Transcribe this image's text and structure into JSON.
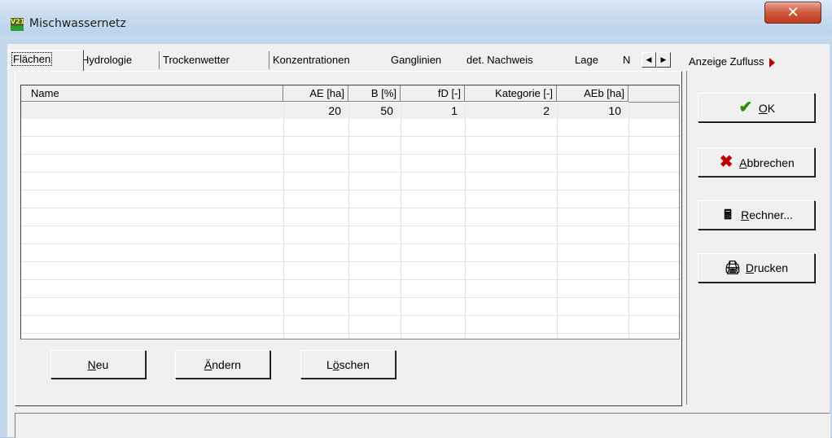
{
  "window": {
    "title": "Mischwassernetz",
    "icon_label": "V21",
    "icon_name": "app-icon",
    "close_label": "✕"
  },
  "tabs": [
    {
      "label": "Flächen",
      "active": true
    },
    {
      "label": "Hydrologie"
    },
    {
      "label": "Trockenwetter"
    },
    {
      "label": "Konzentrationen"
    },
    {
      "label": "Ganglinien"
    },
    {
      "label": "det. Nachweis"
    },
    {
      "label": "Lage"
    },
    {
      "label": "N"
    }
  ],
  "tab_scroll": {
    "left": "◀",
    "right": "▶"
  },
  "side_tab": {
    "label": "Anzeige Zufluss"
  },
  "grid": {
    "columns": [
      "Name",
      "AE [ha]",
      "B [%]",
      "fD [-]",
      "Kategorie [-]",
      "AEb [ha]"
    ],
    "rows": [
      {
        "name": "",
        "ae": "20",
        "b": "50",
        "fd": "1",
        "kategorie": "2",
        "aeb": "10"
      }
    ]
  },
  "buttons": {
    "neu": {
      "accel": "N",
      "rest": "eu"
    },
    "aendern": {
      "accel": "Ä",
      "rest": "ndern"
    },
    "loeschen": {
      "pre": "L",
      "accel": "ö",
      "rest": "schen"
    }
  },
  "side_buttons": {
    "ok": {
      "accel": "O",
      "rest": "K",
      "icon": "checkmark-icon"
    },
    "abbrechen": {
      "accel": "A",
      "rest": "bbrechen",
      "icon": "cross-icon"
    },
    "rechner": {
      "accel": "R",
      "rest": "echner...",
      "icon": "calculator-icon"
    },
    "drucken": {
      "accel": "D",
      "rest": "rucken",
      "icon": "printer-icon"
    }
  },
  "colors": {
    "accent_check": "#2e8b00",
    "cancel_x": "#c00000",
    "arrow_red": "#c00000"
  }
}
